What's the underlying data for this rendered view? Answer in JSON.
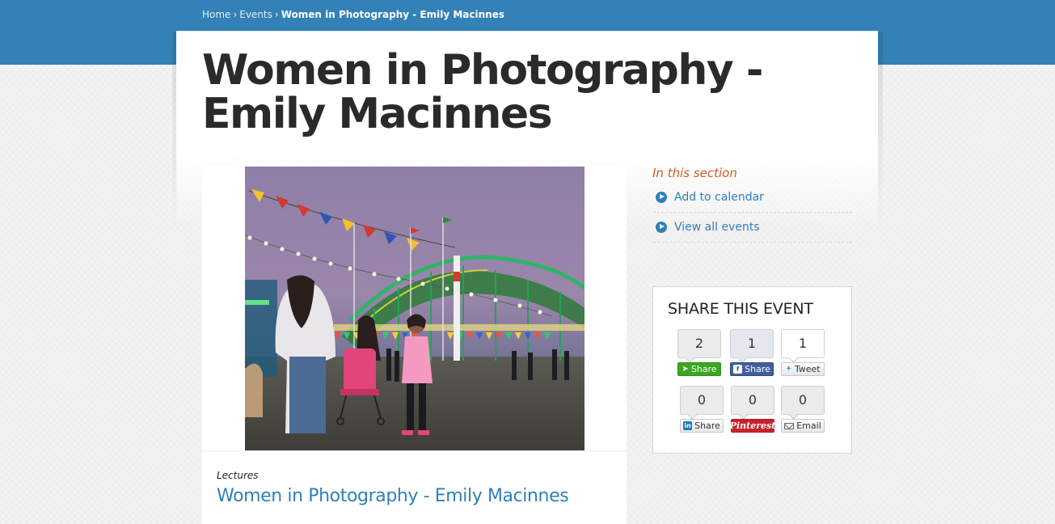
{
  "breadcrumb": {
    "home": "Home",
    "events": "Events",
    "separator": "›",
    "current": "Women in Photography - Emily Macinnes"
  },
  "page_title": "Women in Photography - Emily Macinnes",
  "event": {
    "category": "Lectures",
    "title": "Women in Photography - Emily Macinnes"
  },
  "sidebar": {
    "heading": "In this section",
    "links": [
      {
        "label": "Add to calendar",
        "icon": "play-circle-icon"
      },
      {
        "label": "View all events",
        "icon": "play-circle-icon"
      }
    ]
  },
  "share": {
    "title": "SHARE THIS EVENT",
    "buttons": [
      {
        "count": "2",
        "label": "Share",
        "icon": "share-icon",
        "color": "#3aa81f"
      },
      {
        "count": "1",
        "label": "Share",
        "icon": "facebook-icon",
        "color": "#3f5f9e"
      },
      {
        "count": "1",
        "label": "Tweet",
        "icon": "twitter-icon"
      },
      {
        "count": "0",
        "label": "Share",
        "icon": "linkedin-icon"
      },
      {
        "count": "0",
        "label": "Pinterest",
        "icon": "pinterest-icon",
        "color": "#c8232c"
      },
      {
        "count": "0",
        "label": "Email",
        "icon": "email-icon"
      }
    ]
  },
  "colors": {
    "header_blue": "#3381b6",
    "link_blue": "#2f80b8",
    "section_orange": "#cf5a26"
  }
}
